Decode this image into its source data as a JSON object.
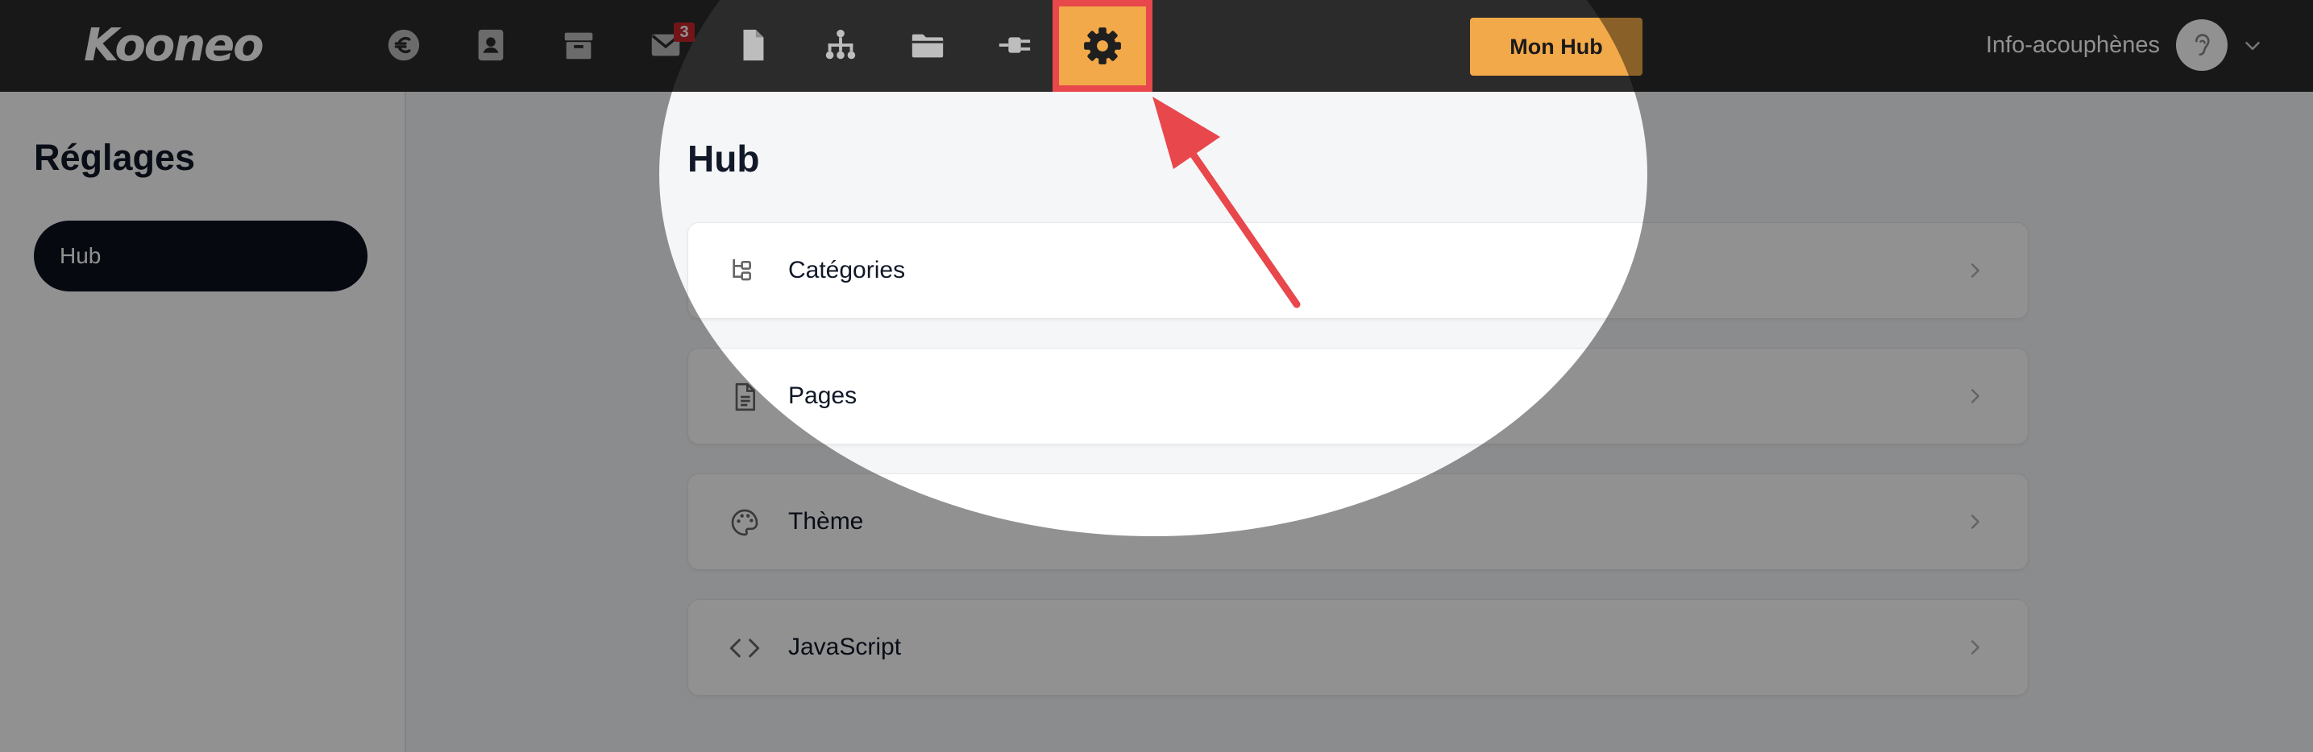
{
  "topbar": {
    "logo": "Kooneo",
    "nav_icons": [
      {
        "name": "euro-icon"
      },
      {
        "name": "contacts-icon"
      },
      {
        "name": "products-icon"
      },
      {
        "name": "mail-icon",
        "badge": "3"
      },
      {
        "name": "document-icon"
      },
      {
        "name": "sitemap-icon"
      },
      {
        "name": "folder-icon"
      },
      {
        "name": "plugin-icon"
      },
      {
        "name": "settings-gear-icon",
        "active": true
      }
    ],
    "hub_button_label": "Mon Hub",
    "user_name": "Info-acouphènes",
    "avatar_icon": "ear-icon"
  },
  "sidebar": {
    "title": "Réglages",
    "items": [
      {
        "label": "Hub",
        "active": true
      }
    ]
  },
  "main": {
    "title": "Hub",
    "cards": [
      {
        "label": "Catégories",
        "icon": "category-tree-icon"
      },
      {
        "label": "Pages",
        "icon": "page-document-icon"
      },
      {
        "label": "Thème",
        "icon": "palette-icon"
      },
      {
        "label": "JavaScript",
        "icon": "code-brackets-icon"
      }
    ]
  },
  "colors": {
    "topbar_bg": "#2b2b2b",
    "accent": "#f2a949",
    "highlight_border": "#e8474c",
    "sidebar_active": "#0c111d",
    "overlay": "rgba(0,0,0,0.43)",
    "arrow": "#e8474c"
  }
}
